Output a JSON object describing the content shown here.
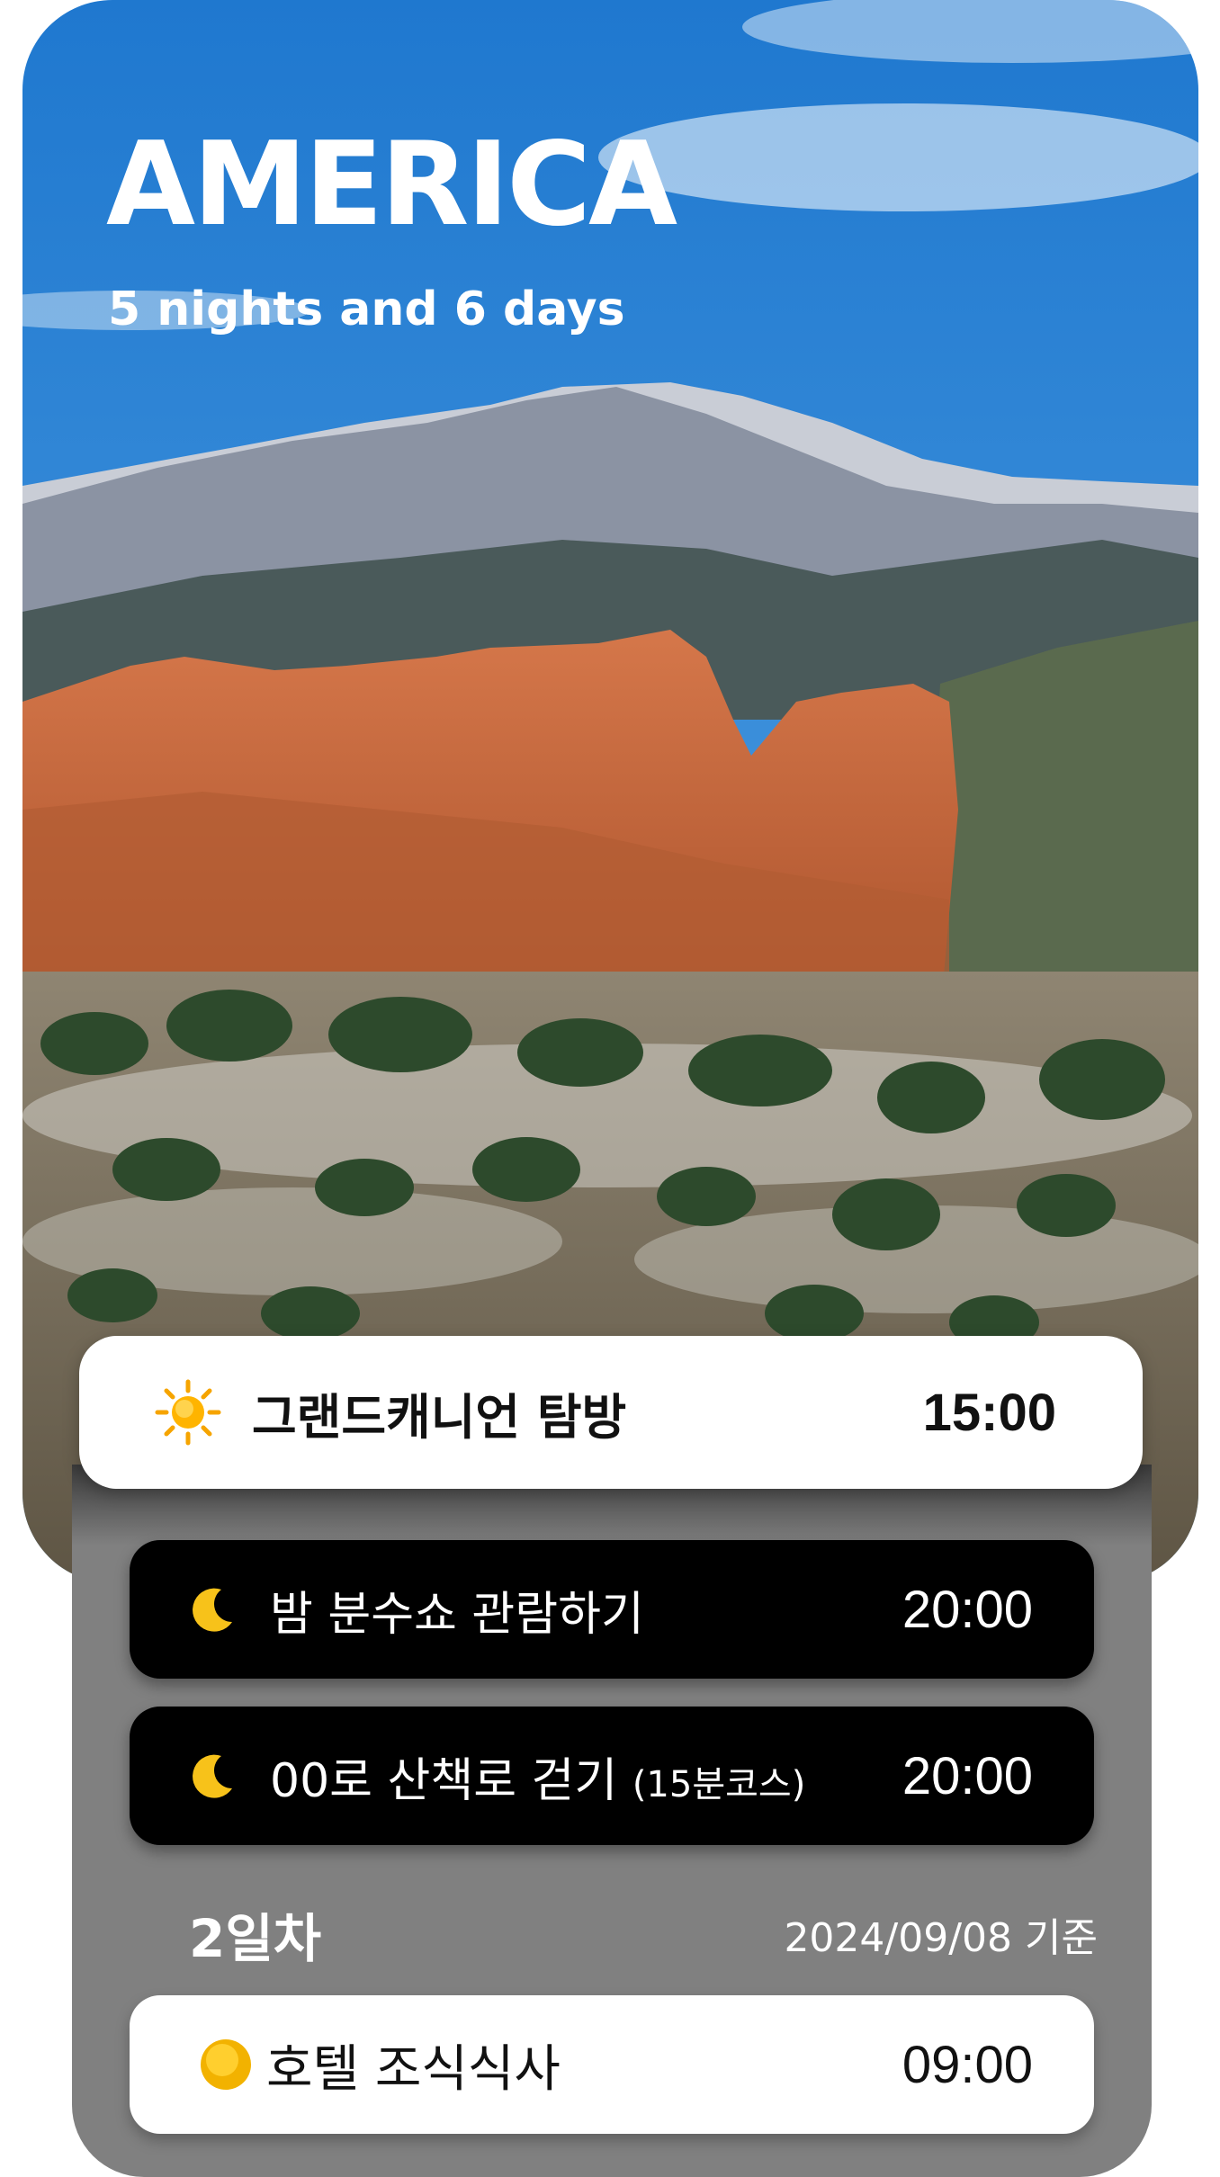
{
  "header": {
    "title": "AMERICA",
    "subtitle": "5 nights and 6 days"
  },
  "schedule": [
    {
      "icon": "sun-icon",
      "label": "그랜드캐니언 탐방",
      "time": "15:00"
    },
    {
      "icon": "moon-icon",
      "label": "밤 분수쇼 관람하기",
      "time": "20:00"
    },
    {
      "icon": "moon-icon",
      "label": "00로 산책로 걷기",
      "label_suffix": "(15분코스)",
      "time": "20:00"
    }
  ],
  "day2": {
    "label": "2일차",
    "date_note": "2024/09/08 기준",
    "items": [
      {
        "icon": "sun-circle-icon",
        "label": "호텔 조식식사",
        "time": "09:00"
      }
    ]
  },
  "colors": {
    "sky": "#2f86d6",
    "rock": "#c8683a",
    "panel": "#808080",
    "dark_card": "#000000",
    "light_card": "#ffffff",
    "sun": "#f9b800"
  }
}
